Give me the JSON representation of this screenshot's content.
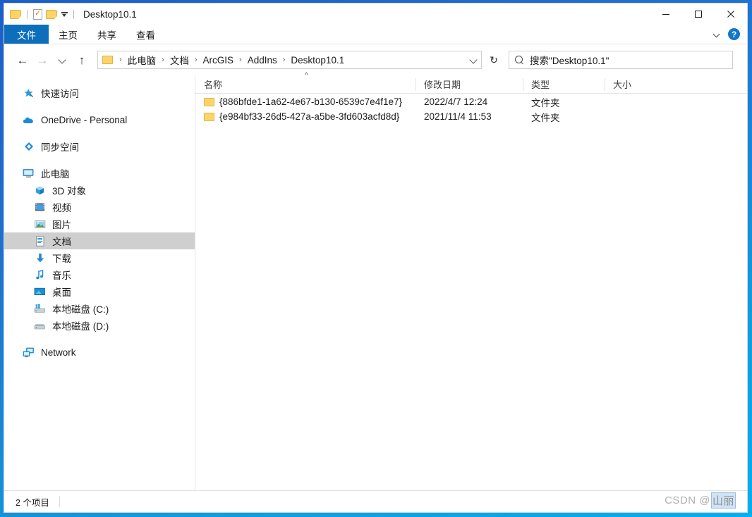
{
  "window": {
    "title": "Desktop10.1",
    "quick_access": [
      {
        "name": "folder-icon",
        "label": "文件夹"
      },
      {
        "name": "properties-icon",
        "label": "属性"
      },
      {
        "name": "new-folder-icon",
        "label": "新建文件夹"
      },
      {
        "name": "customize-caret-icon",
        "label": "自定义快速访问工具栏"
      }
    ],
    "controls": {
      "minimize": "最小化",
      "maximize": "最大化",
      "close": "关闭"
    }
  },
  "ribbon": {
    "tabs": [
      {
        "label": "文件",
        "active": true
      },
      {
        "label": "主页",
        "active": false
      },
      {
        "label": "共享",
        "active": false
      },
      {
        "label": "查看",
        "active": false
      }
    ],
    "collapse_label": "展开功能区",
    "help_label": "?"
  },
  "navbar": {
    "back_label": "←",
    "forward_label": "→",
    "recent_label": "最近浏览的位置",
    "up_label": "↑",
    "refresh_label": "↻",
    "breadcrumbs": [
      "此电脑",
      "文档",
      "ArcGIS",
      "AddIns",
      "Desktop10.1"
    ],
    "separator": "›"
  },
  "search": {
    "icon": "search-icon",
    "placeholder": "搜索\"Desktop10.1\""
  },
  "sidebar": {
    "items": [
      {
        "label": "快速访问",
        "icon": "star-pin-icon",
        "level": 0,
        "selected": false
      },
      {
        "label": "OneDrive - Personal",
        "icon": "cloud-icon",
        "level": 0,
        "selected": false
      },
      {
        "label": "同步空间",
        "icon": "sync-icon",
        "level": 0,
        "selected": false
      },
      {
        "label": "此电脑",
        "icon": "computer-icon",
        "level": 0,
        "selected": false
      },
      {
        "label": "3D 对象",
        "icon": "cube-icon",
        "level": 1,
        "selected": false
      },
      {
        "label": "视频",
        "icon": "video-icon",
        "level": 1,
        "selected": false
      },
      {
        "label": "图片",
        "icon": "pictures-icon",
        "level": 1,
        "selected": false
      },
      {
        "label": "文档",
        "icon": "documents-icon",
        "level": 1,
        "selected": true
      },
      {
        "label": "下载",
        "icon": "download-icon",
        "level": 1,
        "selected": false
      },
      {
        "label": "音乐",
        "icon": "music-icon",
        "level": 1,
        "selected": false
      },
      {
        "label": "桌面",
        "icon": "desktop-icon",
        "level": 1,
        "selected": false
      },
      {
        "label": "本地磁盘 (C:)",
        "icon": "drive-windows-icon",
        "level": 1,
        "selected": false
      },
      {
        "label": "本地磁盘 (D:)",
        "icon": "drive-icon",
        "level": 1,
        "selected": false
      },
      {
        "label": "Network",
        "icon": "network-icon",
        "level": 0,
        "selected": false
      }
    ]
  },
  "filelist": {
    "columns": [
      {
        "label": "名称",
        "sorted": "asc"
      },
      {
        "label": "修改日期",
        "sorted": ""
      },
      {
        "label": "类型",
        "sorted": ""
      },
      {
        "label": "大小",
        "sorted": ""
      }
    ],
    "sort_caret": "^",
    "rows": [
      {
        "name": "{886bfde1-1a62-4e67-b130-6539c7e4f1e7}",
        "modified": "2022/4/7 12:24",
        "type": "文件夹",
        "size": ""
      },
      {
        "name": "{e984bf33-26d5-427a-a5be-3fd603acfd8d}",
        "modified": "2021/11/4 11:53",
        "type": "文件夹",
        "size": ""
      }
    ]
  },
  "statusbar": {
    "item_count": "2 个项目"
  },
  "watermark": {
    "prefix": "CSDN @",
    "suffix": "山丽"
  },
  "colors": {
    "accent": "#0d6ebc",
    "frame_top": "#1a5fc8",
    "frame_bottom": "#00b0f0",
    "selection": "#cfcfcf",
    "folder": "#fbd46a"
  }
}
